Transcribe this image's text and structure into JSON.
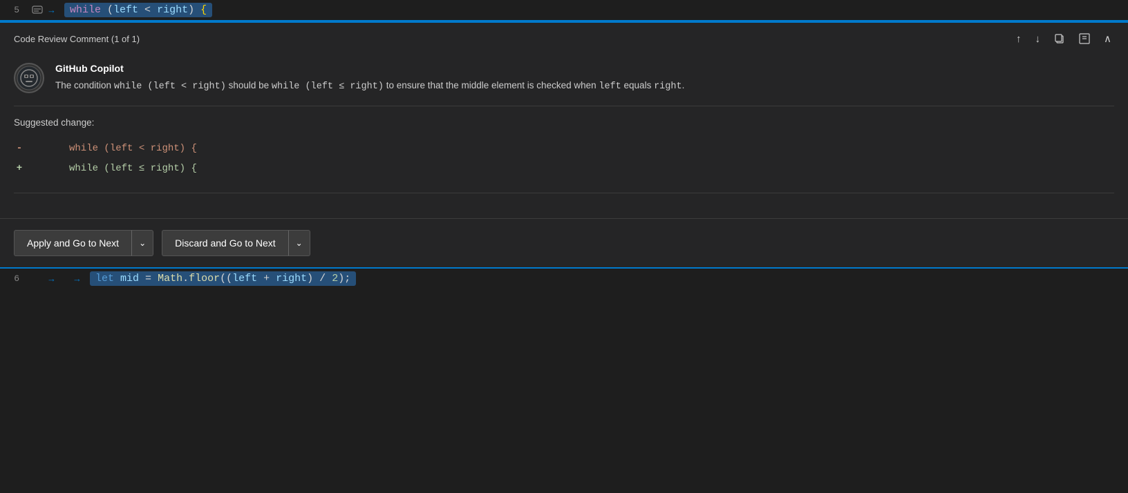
{
  "editor": {
    "top_line": {
      "number": "5",
      "code": "while (left < right) {"
    },
    "bottom_line": {
      "number": "6",
      "code": "let mid = Math.floor((left + right) / 2);"
    }
  },
  "review_panel": {
    "header": {
      "title": "Code Review Comment (1 of 1)",
      "nav_up": "↑",
      "nav_down": "↓",
      "copy_icon": "⧉",
      "close_icon": "⊠",
      "collapse_icon": "∧"
    },
    "comment": {
      "author": "GitHub Copilot",
      "text_before": "The condition ",
      "code1": "while (left < right)",
      "text_middle": " should be ",
      "code2": "while (left ≤ right)",
      "text_after": " to ensure that the middle element is checked when ",
      "code3": "left",
      "text_final1": " equals ",
      "code4": "right",
      "text_final2": "."
    },
    "suggested_change": {
      "label": "Suggested change:",
      "diff_minus_sign": "-",
      "diff_minus_code": "while (left < right) {",
      "diff_plus_sign": "+",
      "diff_plus_code": "while (left ≤ right) {"
    },
    "actions": {
      "apply_btn": "Apply and Go to Next",
      "apply_dropdown": "⌄",
      "discard_btn": "Discard and Go to Next",
      "discard_dropdown": "⌄"
    }
  }
}
